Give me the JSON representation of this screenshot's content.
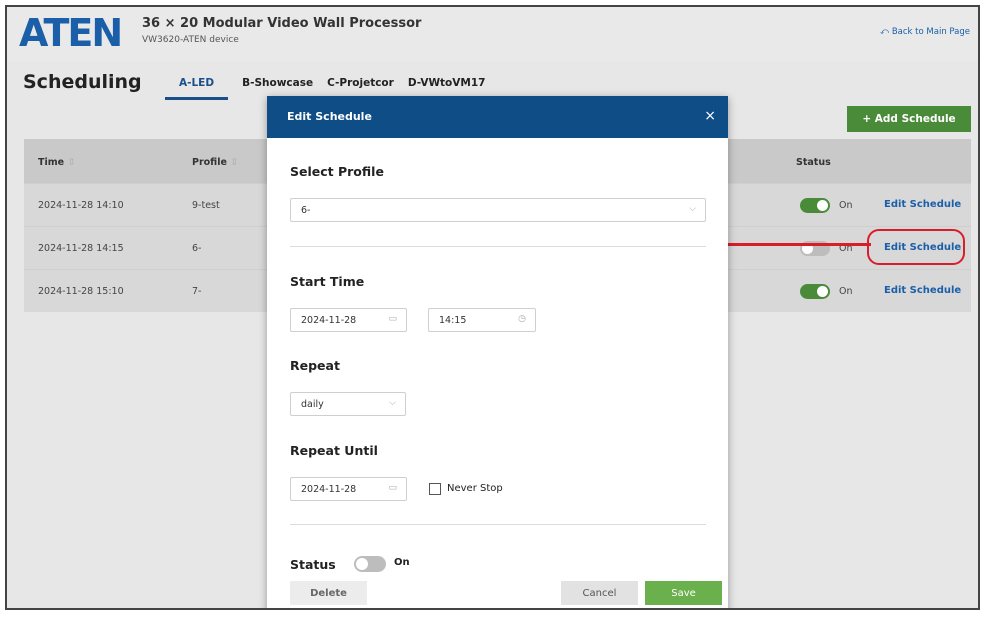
{
  "header": {
    "logo": "ATEN",
    "title": "36 × 20 Modular Video Wall Processor",
    "subtitle": "VW3620-ATEN device",
    "back_link": "Back to Main Page"
  },
  "page": {
    "title": "Scheduling",
    "tabs": [
      {
        "label": "A-LED",
        "active": true
      },
      {
        "label": "B-Showcase",
        "active": false
      },
      {
        "label": "C-Projetcor",
        "active": false
      },
      {
        "label": "D-VWtoVM17",
        "active": false
      }
    ],
    "add_button": "+ Add Schedule"
  },
  "table": {
    "columns": {
      "time": "Time",
      "profile": "Profile",
      "status": "Status"
    },
    "sort_icon": "⇳",
    "rows": [
      {
        "time": "2024-11-28 14:10",
        "profile": "9-test",
        "status": "On",
        "status_on": true,
        "edit": "Edit Schedule"
      },
      {
        "time": "2024-11-28 14:15",
        "profile": "6-",
        "status": "On",
        "status_on": false,
        "edit": "Edit Schedule"
      },
      {
        "time": "2024-11-28 15:10",
        "profile": "7-",
        "status": "On",
        "status_on": true,
        "edit": "Edit Schedule"
      }
    ]
  },
  "modal": {
    "title": "Edit Schedule",
    "close": "×",
    "select_profile_label": "Select Profile",
    "profile_value": "6-",
    "start_time_label": "Start Time",
    "start_date": "2024-11-28",
    "start_time": "14:15",
    "repeat_label": "Repeat",
    "repeat_value": "daily",
    "repeat_until_label": "Repeat Until",
    "until_date": "2024-11-28",
    "never_stop_label": "Never Stop",
    "status_label": "Status",
    "status_value": "On",
    "delete": "Delete",
    "cancel": "Cancel",
    "save": "Save"
  },
  "colors": {
    "brand": "#1b5fa8",
    "modal_header": "#0e4d86",
    "accent_green": "#4a8b3a",
    "highlight_red": "#d81e2a"
  }
}
